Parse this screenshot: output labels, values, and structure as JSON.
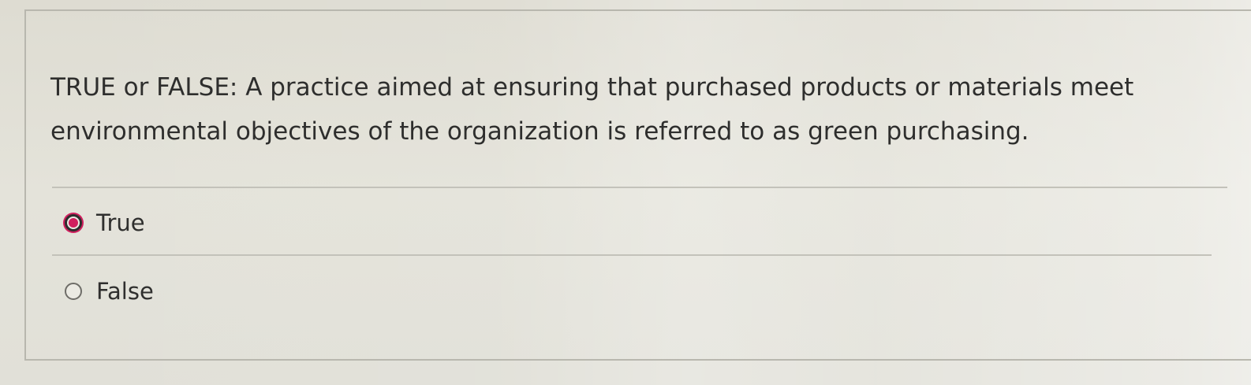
{
  "question": {
    "text": "TRUE or FALSE:  A practice aimed at ensuring that purchased products or materials meet environmental objectives of the organization is referred to as green purchasing."
  },
  "options": [
    {
      "label": "True",
      "selected": true
    },
    {
      "label": "False",
      "selected": false
    }
  ],
  "colors": {
    "selected_accent": "#d01f5e",
    "text": "#2e2e2d",
    "divider": "#c3c2ba"
  }
}
